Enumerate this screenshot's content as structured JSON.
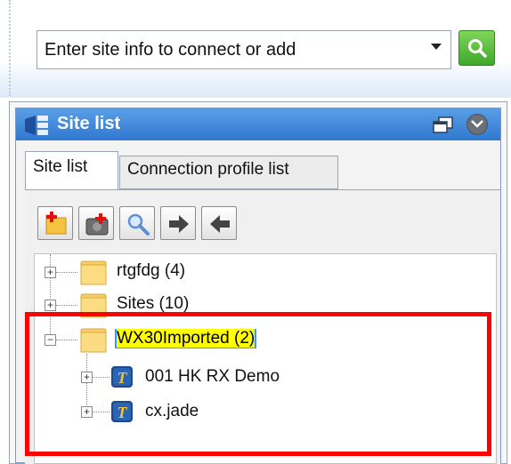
{
  "search": {
    "value": "Enter site info to connect or add",
    "go_icon": "search-icon"
  },
  "panel": {
    "title": "Site list",
    "tabs": [
      {
        "label": "Site list",
        "active": true
      },
      {
        "label": "Connection profile list",
        "active": false
      }
    ],
    "toolbar": [
      {
        "icon": "new-folder-icon"
      },
      {
        "icon": "add-site-icon"
      },
      {
        "icon": "search-icon"
      },
      {
        "icon": "arrow-right-icon"
      },
      {
        "icon": "arrow-left-icon"
      }
    ]
  },
  "tree": {
    "nodes": [
      {
        "label": "rtgfdg (4)",
        "type": "folder",
        "expanded": false
      },
      {
        "label": "Sites (10)",
        "type": "folder",
        "expanded": false
      },
      {
        "label": "WX30Imported (2)",
        "type": "folder",
        "expanded": true,
        "selected": true,
        "children": [
          {
            "label": "001 HK RX Demo",
            "type": "site"
          },
          {
            "label": "cx.jade",
            "type": "site"
          }
        ]
      }
    ]
  },
  "colors": {
    "highlight": "#ff0000",
    "titlebar": "#3a85d8",
    "selection": "#3399ff",
    "selection_text_bg": "#ffff00"
  }
}
